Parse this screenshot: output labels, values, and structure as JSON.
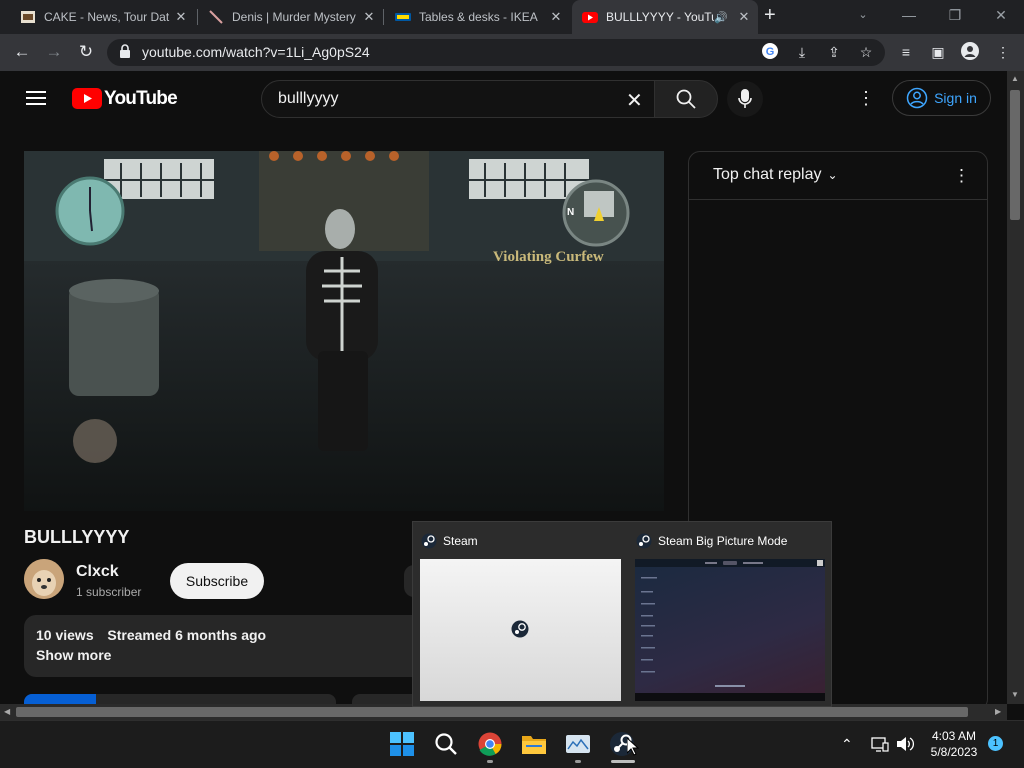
{
  "browser": {
    "tabs": [
      {
        "title": "CAKE - News, Tour Dat",
        "active": false
      },
      {
        "title": "Denis | Murder Mystery",
        "active": false
      },
      {
        "title": "Tables & desks - IKEA",
        "active": false
      },
      {
        "title": "BULLLYYYY - YouTu",
        "active": true
      }
    ],
    "new_tab": "+",
    "url": "youtube.com/watch?v=1Li_Ag0pS24"
  },
  "youtube": {
    "logo_text": "YouTube",
    "search_value": "bulllyyyy",
    "sign_in": "Sign in",
    "hud_text": "Violating Curfew",
    "minimap_north": "N",
    "chat_title": "Top chat replay",
    "video_title": "BULLLYYYY",
    "channel_name": "Clxck",
    "subscribers": "1 subscriber",
    "subscribe_label": "Subscribe",
    "views": "10 views",
    "streamed": "Streamed 6 months ago",
    "show_more": "Show more"
  },
  "popup": {
    "items": [
      {
        "title": "Steam"
      },
      {
        "title": "Steam Big Picture Mode"
      }
    ]
  },
  "taskbar": {
    "time": "4:03 AM",
    "date": "5/8/2023",
    "notification_count": "1"
  },
  "colors": {
    "youtube_red": "#ff0000",
    "link_blue": "#3ea6ff",
    "chrome_dark": "#202124",
    "page_bg": "#0f0f0f"
  }
}
